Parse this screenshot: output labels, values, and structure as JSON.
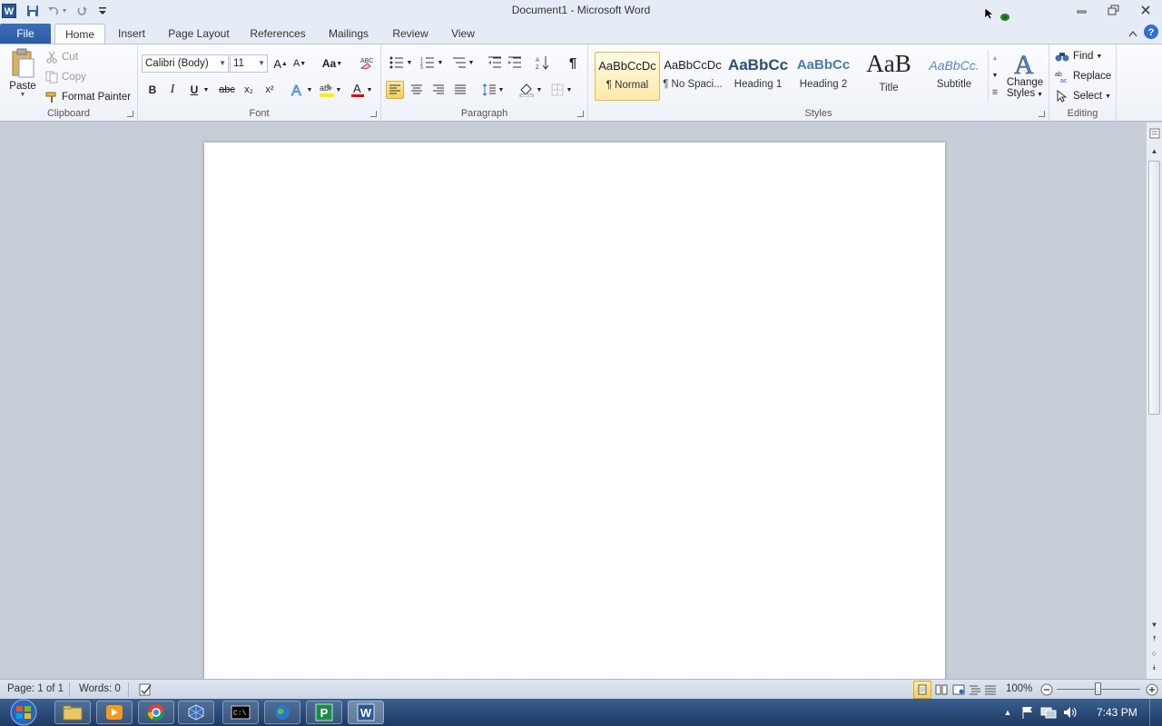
{
  "window": {
    "title": "Document1  -  Microsoft Word",
    "app_icon": "word-app-icon",
    "quick_access": [
      "save-icon",
      "undo-icon",
      "redo-icon",
      "customize-qat-icon"
    ],
    "controls": [
      "minimize-icon",
      "restore-icon",
      "close-icon"
    ]
  },
  "tabs": [
    {
      "label": "File"
    },
    {
      "label": "Home"
    },
    {
      "label": "Insert"
    },
    {
      "label": "Page Layout"
    },
    {
      "label": "References"
    },
    {
      "label": "Mailings"
    },
    {
      "label": "Review"
    },
    {
      "label": "View"
    }
  ],
  "ribbon": {
    "clipboard": {
      "label": "Clipboard",
      "paste": "Paste",
      "cut": "Cut",
      "copy": "Copy",
      "format_painter": "Format Painter"
    },
    "font": {
      "label": "Font",
      "font_name": "Calibri (Body)",
      "font_size": "11",
      "change_case": "Aa",
      "bold": "B",
      "italic": "I",
      "underline": "U",
      "strikethrough": "abc",
      "subscript": "x₂",
      "superscript": "x²"
    },
    "paragraph": {
      "label": "Paragraph",
      "pilcrow": "¶"
    },
    "styles": {
      "label": "Styles",
      "items": [
        {
          "preview": "AaBbCcDc",
          "name": "¶ Normal"
        },
        {
          "preview": "AaBbCcDc",
          "name": "¶ No Spaci..."
        },
        {
          "preview": "AaBbCc",
          "name": "Heading 1"
        },
        {
          "preview": "AaBbCc",
          "name": "Heading 2"
        },
        {
          "preview": "AaB",
          "name": "Title"
        },
        {
          "preview": "AaBbCc.",
          "name": "Subtitle"
        }
      ],
      "change_styles_1": "Change",
      "change_styles_2": "Styles"
    },
    "editing": {
      "label": "Editing",
      "find": "Find",
      "replace": "Replace",
      "select": "Select"
    }
  },
  "status": {
    "page": "Page: 1 of 1",
    "words": "Words: 0",
    "zoom": "100%",
    "zoom_level": 100
  },
  "taskbar": {
    "time": "7:43 PM",
    "apps": [
      "start-orb-icon",
      "explorer-icon",
      "media-player-icon",
      "chrome-icon",
      "virtualbox-icon",
      "cmd-icon",
      "globe-icon",
      "publisher-icon",
      "word-icon"
    ]
  }
}
